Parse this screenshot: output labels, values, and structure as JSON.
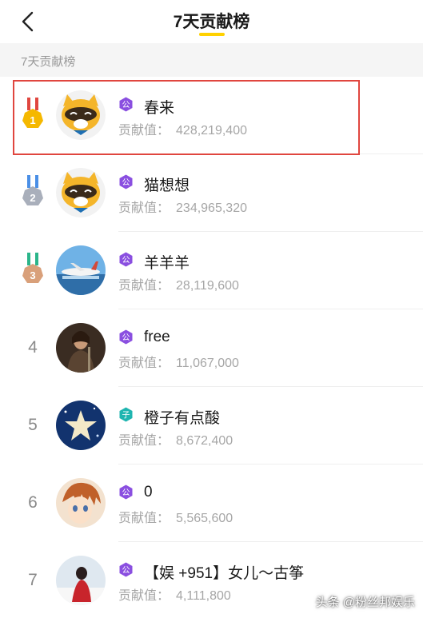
{
  "header": {
    "title": "7天贡献榜"
  },
  "section": {
    "label": "7天贡献榜"
  },
  "contrib_label": "贡献值：",
  "rows": [
    {
      "rank": "1",
      "medal": "gold",
      "name": "春来",
      "badge": "公",
      "badge_color": "#8a4fe0",
      "value": "428,219,400",
      "avatar": "mascot"
    },
    {
      "rank": "2",
      "medal": "silver",
      "name": "猫想想",
      "badge": "公",
      "badge_color": "#8a4fe0",
      "value": "234,965,320",
      "avatar": "mascot"
    },
    {
      "rank": "3",
      "medal": "bronze",
      "name": "羊羊羊",
      "badge": "公",
      "badge_color": "#8a4fe0",
      "value": "28,119,600",
      "avatar": "airplane"
    },
    {
      "rank": "4",
      "medal": "",
      "name": "free",
      "badge": "公",
      "badge_color": "#8a4fe0",
      "value": "11,067,000",
      "avatar": "warrior"
    },
    {
      "rank": "5",
      "medal": "",
      "name": "橙子有点酸",
      "badge": "子",
      "badge_color": "#1fb5b0",
      "value": "8,672,400",
      "avatar": "star"
    },
    {
      "rank": "6",
      "medal": "",
      "name": "0",
      "badge": "公",
      "badge_color": "#8a4fe0",
      "value": "5,565,600",
      "avatar": "anime"
    },
    {
      "rank": "7",
      "medal": "",
      "name": "【娱 +951】女儿～古筝",
      "badge": "公",
      "badge_color": "#8a4fe0",
      "value": "4,111,800",
      "avatar": "snow"
    }
  ],
  "watermark": "头条 @粉丝邦娱乐",
  "colors": {
    "accent": "#ffd100",
    "highlight_border": "#e0463f",
    "gold": "#f5b800",
    "silver": "#a9afbb",
    "bronze": "#d9a07a"
  }
}
